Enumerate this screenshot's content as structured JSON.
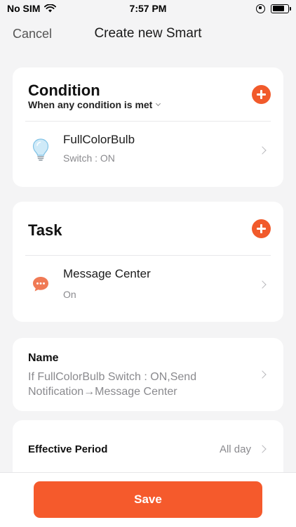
{
  "status_bar": {
    "carrier": "No SIM",
    "time": "7:57 PM"
  },
  "nav": {
    "cancel_label": "Cancel",
    "title": "Create new Smart"
  },
  "condition": {
    "title": "Condition",
    "mode_label": "When any condition is met",
    "items": [
      {
        "title": "FullColorBulb",
        "subtitle": "Switch : ON",
        "icon": "bulb-icon"
      }
    ]
  },
  "task": {
    "title": "Task",
    "items": [
      {
        "title": "Message Center",
        "subtitle": "On",
        "icon": "message-icon"
      }
    ]
  },
  "name": {
    "label": "Name",
    "value": "If FullColorBulb Switch : ON,Send Notification→Message Center"
  },
  "effective_period": {
    "label": "Effective Period",
    "value": "All day"
  },
  "footer": {
    "save_label": "Save"
  },
  "colors": {
    "accent": "#f15a2b",
    "save_button": "#f55a2c",
    "background": "#f4f4f5"
  }
}
